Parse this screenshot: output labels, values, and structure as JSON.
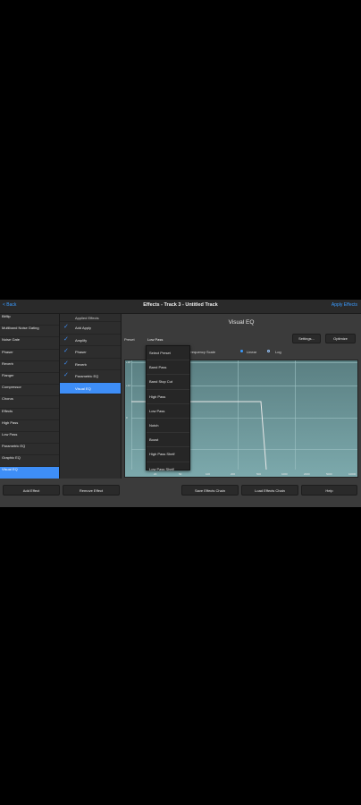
{
  "topbar": {
    "back_label": "< Back",
    "title": "Effects - Track 3 - Untitled Track",
    "apply_label": "Apply Effects"
  },
  "effects_list": [
    "Bitflip",
    "Multiband Noise Gating",
    "Noise Gate",
    "Phaser",
    "Reverb",
    "Flanger",
    "Compressor",
    "Chorus",
    "Effects",
    "High Pass",
    "Low Pass",
    "Parametric EQ",
    "Graphic EQ",
    "Visual EQ"
  ],
  "effects_selected_index": 13,
  "applied_header": "Applied Effects",
  "applied_list": [
    {
      "label": "Add Apply",
      "checked": true
    },
    {
      "label": "Amplify",
      "checked": true
    },
    {
      "label": "Phaser",
      "checked": true
    },
    {
      "label": "Reverb",
      "checked": true
    },
    {
      "label": "Parametric EQ",
      "checked": true
    },
    {
      "label": "Visual EQ",
      "checked": false
    }
  ],
  "applied_selected_index": 5,
  "eq": {
    "title": "Visual EQ",
    "settings_label": "Settings...",
    "optimize_label": "Optimize",
    "preset_label": "Preset",
    "preset_value": "Low Pass",
    "freq_scale_label": "Frequency Scale",
    "scale_linear": "Linear",
    "scale_log": "Log",
    "scale_selected": "Linear"
  },
  "preset_options": [
    "Select Preset",
    "Band Pass",
    "Band Stop Cut",
    "High Pass",
    "Low Pass",
    "Notch",
    "Boost",
    "High Pass Shelf",
    "Low Pass Shelf"
  ],
  "graph_y_labels": [
    "+18",
    "+12",
    "0"
  ],
  "graph_x_labels": [
    "20",
    "50",
    "100",
    "200",
    "500",
    "1000",
    "2000",
    "5000",
    "10000"
  ],
  "bottom_buttons": {
    "add_effect": "Add Effect",
    "remove_effect": "Remove Effect",
    "save_chain": "Save Effects Chain",
    "load_chain": "Load Effects Chain",
    "help": "Help"
  },
  "colors": {
    "accent": "#3e8ef7",
    "panel": "#3b3b3b",
    "graph": "#6f9a9d"
  }
}
